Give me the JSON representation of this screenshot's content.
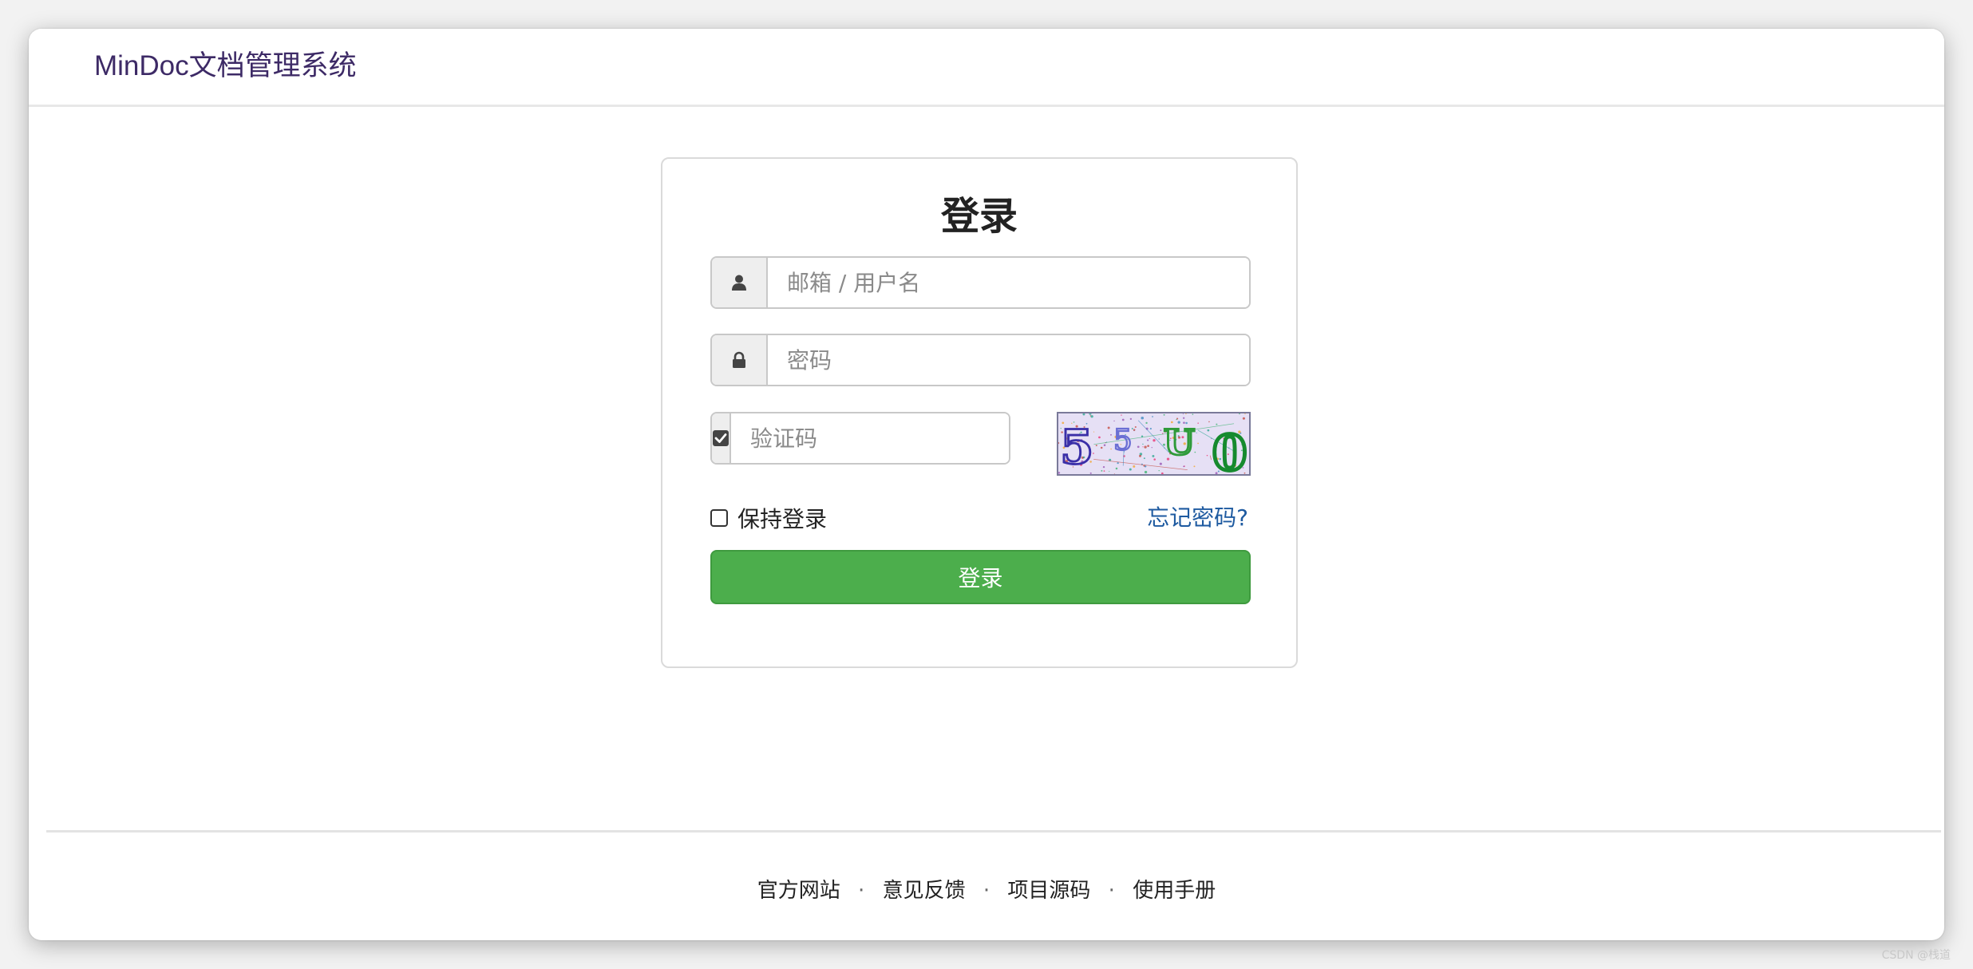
{
  "header": {
    "brand": "MinDoc文档管理系统"
  },
  "login": {
    "title": "登录",
    "username_placeholder": "邮箱 / 用户名",
    "password_placeholder": "密码",
    "captcha_placeholder": "验证码",
    "captcha_text": [
      "5",
      "5",
      "U",
      "0"
    ],
    "remember_label": "保持登录",
    "forgot_link": "忘记密码?",
    "submit_label": "登录"
  },
  "footer": {
    "links": [
      "官方网站",
      "意见反馈",
      "项目源码",
      "使用手册"
    ],
    "separator": "·"
  },
  "watermark": "CSDN @栈道",
  "colors": {
    "brand": "#3d2a66",
    "button": "#4cae4c",
    "link": "#1e5aa0"
  }
}
